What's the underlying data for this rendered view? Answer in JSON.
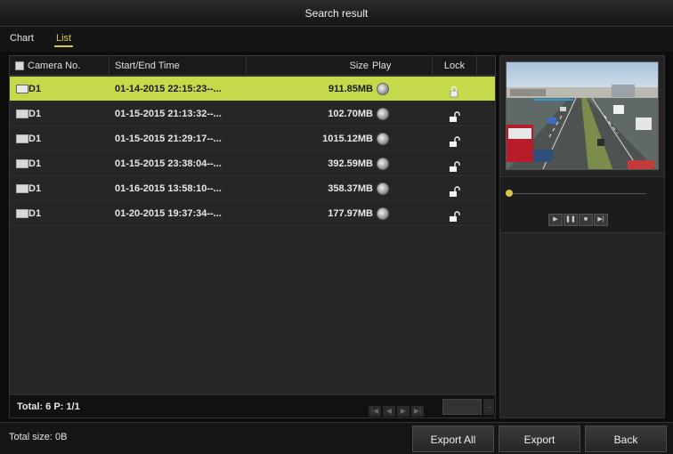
{
  "window": {
    "title": "Search result"
  },
  "tabs": [
    {
      "label": "Chart",
      "active": false
    },
    {
      "label": "List",
      "active": true
    }
  ],
  "table": {
    "headers": {
      "camera": "Camera No.",
      "time": "Start/End Time",
      "size": "Size",
      "play": "Play",
      "lock": "Lock"
    },
    "rows": [
      {
        "camera": "D1",
        "time": "01-14-2015 22:15:23--...",
        "size": "911.85MB",
        "locked": true,
        "selected": true
      },
      {
        "camera": "D1",
        "time": "01-15-2015 21:13:32--...",
        "size": "102.70MB",
        "locked": false,
        "selected": false
      },
      {
        "camera": "D1",
        "time": "01-15-2015 21:29:17--...",
        "size": "1015.12MB",
        "locked": false,
        "selected": false
      },
      {
        "camera": "D1",
        "time": "01-15-2015 23:38:04--...",
        "size": "392.59MB",
        "locked": false,
        "selected": false
      },
      {
        "camera": "D1",
        "time": "01-16-2015 13:58:10--...",
        "size": "358.37MB",
        "locked": false,
        "selected": false
      },
      {
        "camera": "D1",
        "time": "01-20-2015 19:37:34--...",
        "size": "177.97MB",
        "locked": false,
        "selected": false
      }
    ]
  },
  "pagination": {
    "total": "Total: 6  P: 1/1"
  },
  "footer": {
    "total_size": "Total size: 0B",
    "export_all": "Export All",
    "export": "Export",
    "back": "Back"
  },
  "colors": {
    "accent": "#d4c84a",
    "selected_row": "#c6d94a",
    "background": "#0d0d0d"
  },
  "icons": {
    "play": "play-icon",
    "lock_closed": "lock-closed-icon",
    "lock_open": "lock-open-icon",
    "pager": [
      "first-page-icon",
      "prev-page-icon",
      "next-page-icon",
      "last-page-icon"
    ],
    "player": [
      "play-icon",
      "pause-icon",
      "stop-icon",
      "step-forward-icon"
    ]
  }
}
